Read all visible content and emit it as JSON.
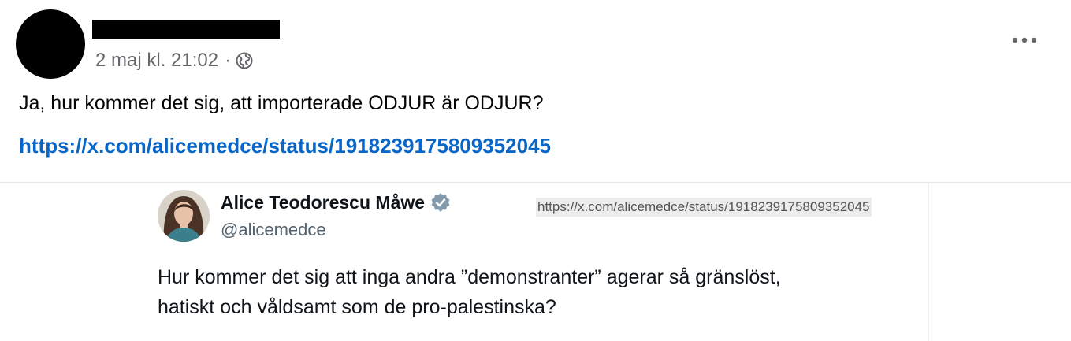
{
  "post": {
    "timestamp": "2 maj kl. 21:02",
    "separator": "·",
    "visibility_icon": "globe-icon",
    "more_icon": "more-options-icon",
    "text": "Ja, hur kommer det sig, att importerade ODJUR är ODJUR?",
    "link": "https://x.com/alicemedce/status/1918239175809352045"
  },
  "embedded_tweet": {
    "author_name": "Alice Teodorescu Måwe",
    "verified_icon": "verified-badge-icon",
    "handle": "@alicemedce",
    "url_stamp": "https://x.com/alicemedce/status/1918239175809352045",
    "text_line1": "Hur kommer det sig att inga andra ”demonstranter” agerar så gränslöst,",
    "text_line2": "hatiskt och våldsamt som de pro-palestinska?"
  },
  "colors": {
    "link": "#0866c8",
    "meta_text": "#65676b",
    "body_text": "#050505",
    "verified_badge": "#829aab"
  }
}
